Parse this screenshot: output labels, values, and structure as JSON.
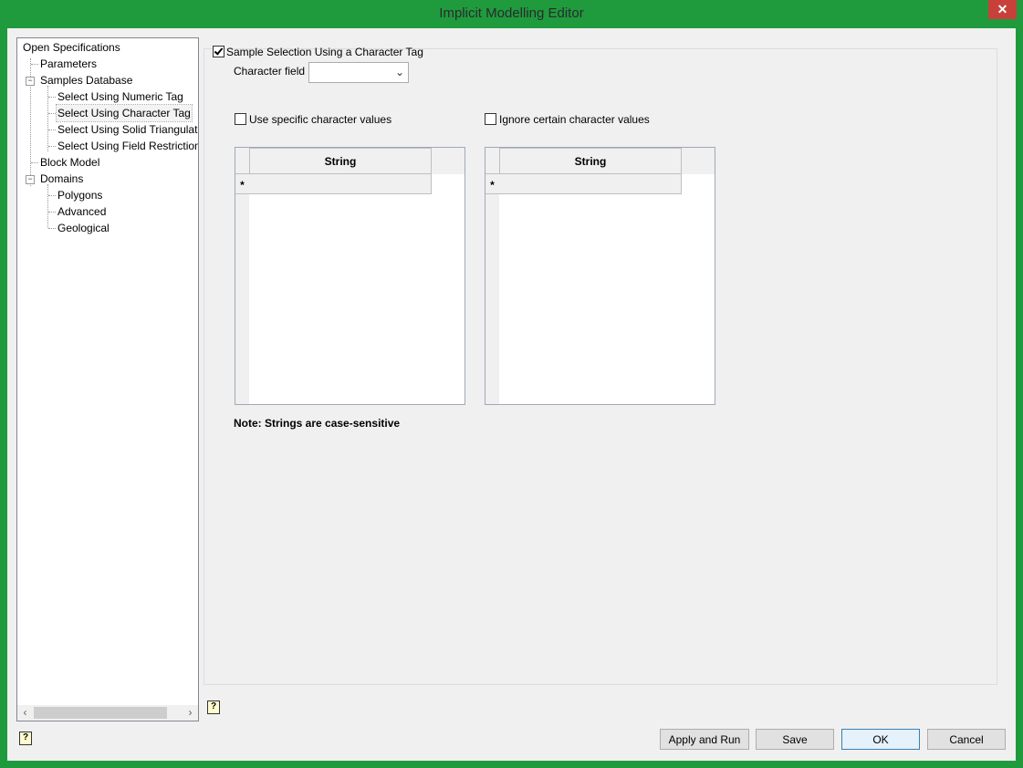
{
  "window": {
    "title": "Implicit Modelling Editor",
    "close_glyph": "✕"
  },
  "tree": {
    "items": [
      {
        "label": "Open Specifications"
      },
      {
        "label": "Parameters"
      },
      {
        "label": "Samples Database"
      },
      {
        "label": "Select Using Numeric Tag"
      },
      {
        "label": "Select Using Character Tag"
      },
      {
        "label": "Select Using Solid Triangulati"
      },
      {
        "label": "Select Using Field Restrictions"
      },
      {
        "label": "Block Model"
      },
      {
        "label": "Domains"
      },
      {
        "label": "Polygons"
      },
      {
        "label": "Advanced"
      },
      {
        "label": "Geological"
      }
    ],
    "selected_index": 4
  },
  "panel": {
    "main_checkbox_label": "Sample Selection Using a Character Tag",
    "main_checkbox_checked": true,
    "character_field_label": "Character field",
    "character_field_value": "",
    "use_specific_label": "Use specific character values",
    "use_specific_checked": false,
    "ignore_certain_label": "Ignore certain character values",
    "ignore_certain_checked": false,
    "left_grid": {
      "column": "String",
      "new_row_marker": "*"
    },
    "right_grid": {
      "column": "String",
      "new_row_marker": "*"
    },
    "note": "Note: Strings are case-sensitive"
  },
  "buttons": {
    "apply_and_run": "Apply and Run",
    "save": "Save",
    "ok": "OK",
    "cancel": "Cancel"
  },
  "icons": {
    "help": "?",
    "scroll_left": "‹",
    "scroll_right": "›",
    "dropdown": "⌄",
    "expander_minus": "−"
  },
  "colors": {
    "window_frame": "#1f9b3e",
    "close_button": "#c7413a",
    "client_bg": "#f0f0f0"
  }
}
